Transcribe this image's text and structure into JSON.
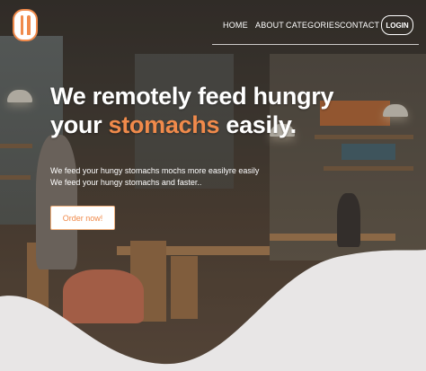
{
  "nav": {
    "links": [
      {
        "label": "HOME"
      },
      {
        "label": "ABOUT"
      },
      {
        "label": "CATEGORIES"
      },
      {
        "label": "CONTACT"
      }
    ],
    "login_label": "LOGIN"
  },
  "hero": {
    "headline_line1": "We remotely feed hungry",
    "headline_word2a": "your",
    "headline_accent": "stomachs",
    "headline_word2b": "easily.",
    "sub_line1": "We feed your hungy stomachs mochs more easilyre easily",
    "sub_line2": "We feed your hungy stomachs and faster..",
    "cta_label": "Order now!"
  },
  "colors": {
    "accent": "#f08a4b",
    "text": "#ffffff",
    "wave": "#e8e6e6"
  },
  "icons": {
    "logo": "fork-knife-icon"
  }
}
